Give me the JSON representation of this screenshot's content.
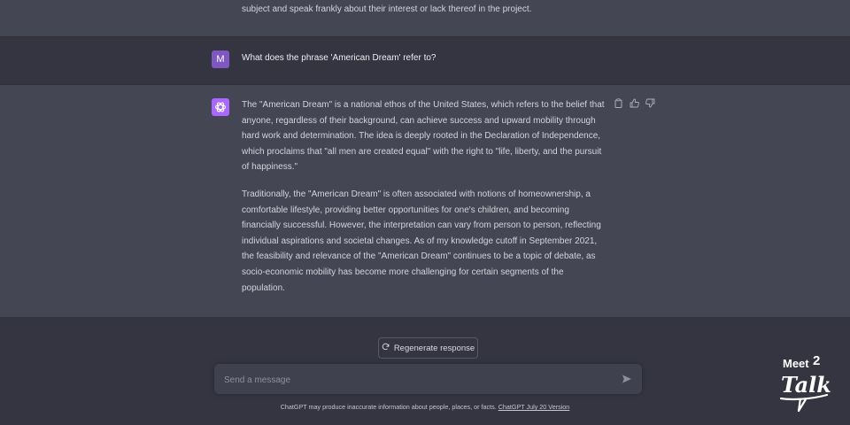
{
  "conversation": {
    "prev_tail": "subject and speak frankly about their interest or lack thereof in the project.",
    "user": {
      "avatar_letter": "M",
      "message": "What does the phrase 'American Dream' refer to?"
    },
    "assistant": {
      "paragraphs": [
        "The \"American Dream\" is a national ethos of the United States, which refers to the belief that anyone, regardless of their background, can achieve success and upward mobility through hard work and determination. The idea is deeply rooted in the Declaration of Independence, which proclaims that \"all men are created equal\" with the right to \"life, liberty, and the pursuit of happiness.\"",
        "Traditionally, the \"American Dream\" is often associated with notions of homeownership, a comfortable lifestyle, providing better opportunities for one's children, and becoming financially successful. However, the interpretation can vary from person to person, reflecting individual aspirations and societal changes. As of my knowledge cutoff in September 2021, the feasibility and relevance of the \"American Dream\" continues to be a topic of debate, as socio-economic mobility has become more challenging for certain segments of the population."
      ]
    }
  },
  "actions": {
    "regenerate_label": "Regenerate response"
  },
  "composer": {
    "placeholder": "Send a message"
  },
  "footer": {
    "text": "ChatGPT may produce inaccurate information about people, places, or facts. ",
    "link": "ChatGPT July 20 Version"
  },
  "watermark": {
    "line1": "Meet",
    "sup": "2",
    "line2": "Talk"
  },
  "icons": {
    "sidebar": "sidebar-toggle-icon",
    "assistant_avatar": "openai-logo-icon",
    "copy": "clipboard-icon",
    "like": "thumbs-up-icon",
    "dislike": "thumbs-down-icon",
    "regenerate": "refresh-icon",
    "send": "paper-plane-icon"
  },
  "colors": {
    "background": "#343541",
    "assistant_row": "#444654",
    "user_avatar": "#7e57c2",
    "assistant_avatar": "#ab68ff"
  }
}
